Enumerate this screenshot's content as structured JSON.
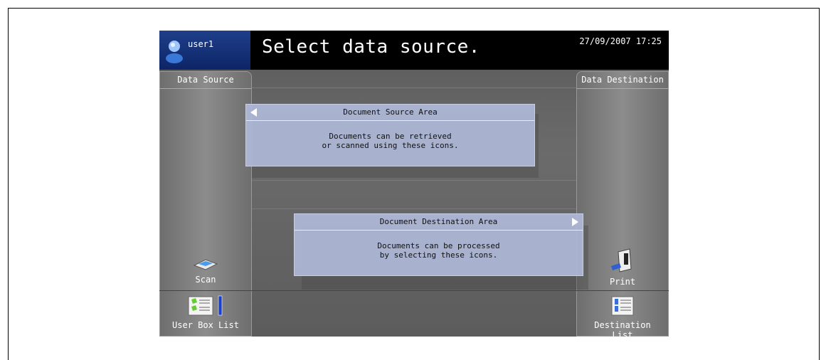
{
  "header": {
    "user": "user1",
    "title": "Select data source.",
    "datetime": "27/09/2007 17:25"
  },
  "left_panel": {
    "heading": "Data Source",
    "scan_label": "Scan",
    "user_box_label": "User Box List"
  },
  "right_panel": {
    "heading": "Data Destination",
    "print_label": "Print",
    "destination_label": "Destination List"
  },
  "source_balloon": {
    "title": "Document Source Area",
    "line1": "Documents can be retrieved",
    "line2": "or scanned using these icons."
  },
  "destination_balloon": {
    "title": "Document Destination Area",
    "line1": "Documents can be processed",
    "line2": "by selecting these icons."
  },
  "colors": {
    "header_bg": "#000000",
    "user_bg": "#1f3f8a",
    "balloon_bg": "#afb9d7"
  },
  "icons": [
    "user-icon",
    "scanner-icon",
    "user-box-icon",
    "printer-icon",
    "destination-list-icon",
    "arrow-left-icon",
    "arrow-right-icon"
  ]
}
